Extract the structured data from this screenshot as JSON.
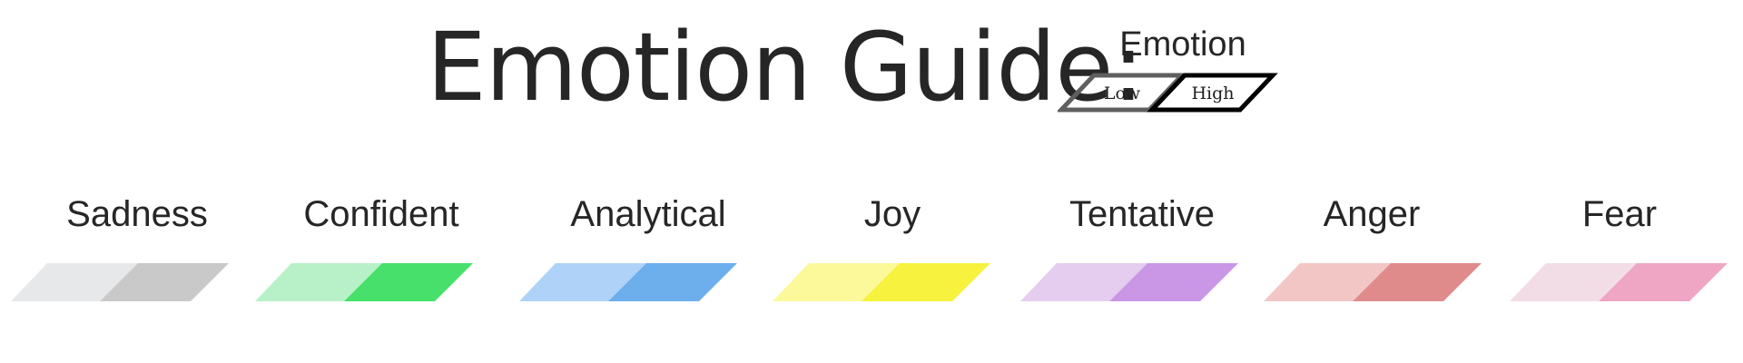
{
  "title": "Emotion Guide:",
  "legend": {
    "title": "Emotion",
    "low_label": "Low",
    "high_label": "High",
    "low_border_color": "#5f5f5f",
    "high_border_color": "#000000"
  },
  "emotions": [
    {
      "name": "Sadness",
      "low_color": "#e7e8ea",
      "high_color": "#c9c9c9"
    },
    {
      "name": "Confident",
      "low_color": "#b8f1c8",
      "high_color": "#46e06a"
    },
    {
      "name": "Analytical",
      "low_color": "#aed2f8",
      "high_color": "#6daeec"
    },
    {
      "name": "Joy",
      "low_color": "#fbf99a",
      "high_color": "#f6f23d"
    },
    {
      "name": "Tentative",
      "low_color": "#e5cdef",
      "high_color": "#c997e6"
    },
    {
      "name": "Anger",
      "low_color": "#f3c6c6",
      "high_color": "#e08b8b"
    },
    {
      "name": "Fear",
      "low_color": "#f2dde6",
      "high_color": "#efa6c4"
    }
  ]
}
